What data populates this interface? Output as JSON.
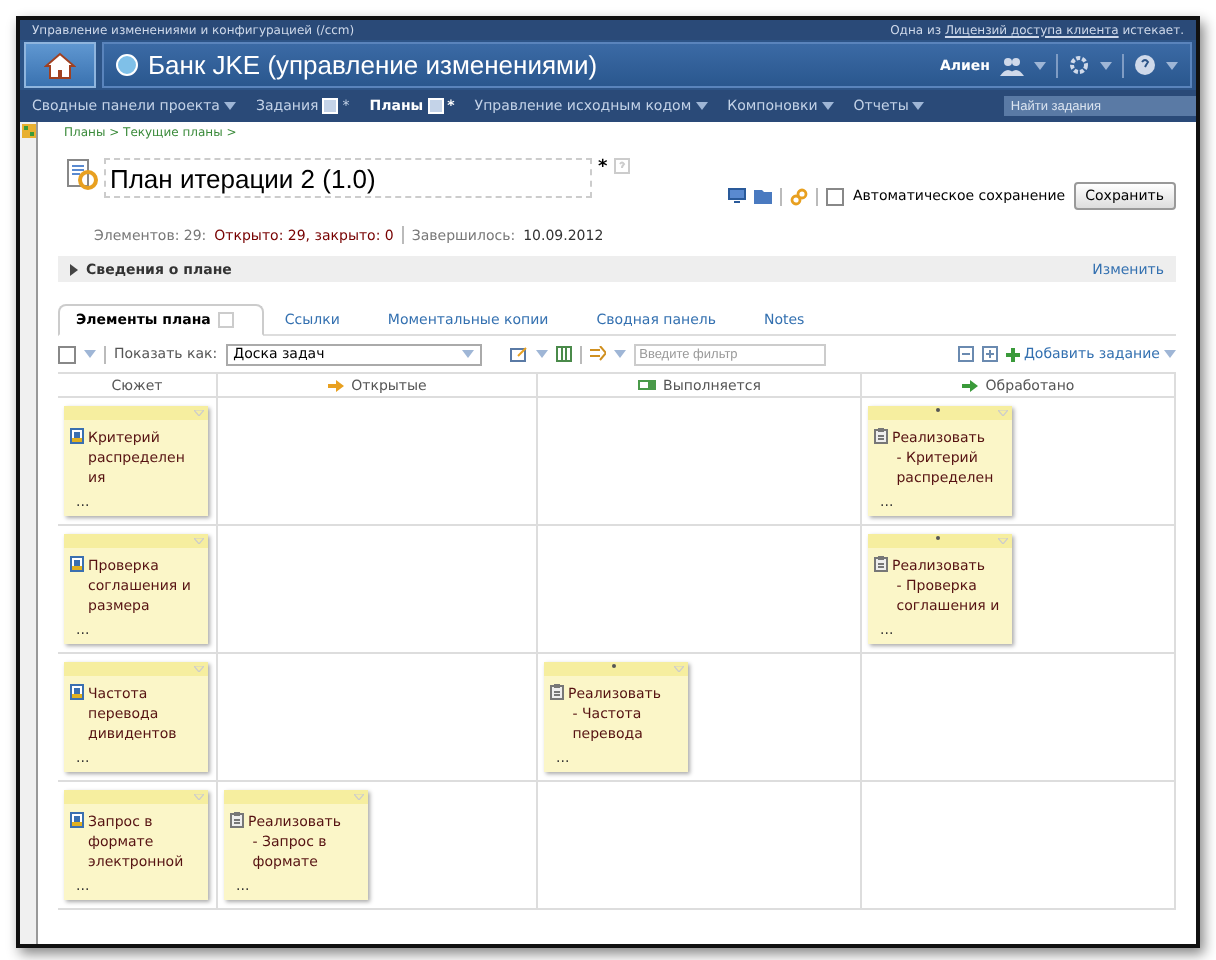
{
  "top_strip": {
    "app": "Управление изменениями и конфигурацией (/ccm)",
    "notice_before": "Одна из",
    "notice_link": "Лицензий доступа клиента",
    "notice_after": "истекает."
  },
  "header": {
    "title": "Банк JKE (управление изменениями)",
    "user": "Алиен"
  },
  "nav": [
    {
      "label": "Сводные панели проекта",
      "kind": "menu",
      "selected": false
    },
    {
      "label": "Задания",
      "kind": "new",
      "selected": false
    },
    {
      "label": "Планы",
      "kind": "new",
      "selected": true
    },
    {
      "label": "Управление исходным кодом",
      "kind": "menu",
      "selected": false
    },
    {
      "label": "Компоновки",
      "kind": "menu",
      "selected": false
    },
    {
      "label": "Отчеты",
      "kind": "menu",
      "selected": false
    }
  ],
  "search": {
    "placeholder": "Найти задания"
  },
  "breadcrumb": "Планы > Текущие планы >",
  "plan": {
    "title": "План итерации 2 (1.0)",
    "modified_mark": "*",
    "autosave_label": "Автоматическое сохранение",
    "autosave": false,
    "save": "Сохранить"
  },
  "stats": {
    "items": "Элементов: 29:",
    "open_closed": "Открыто: 29, закрыто: 0",
    "ended_label": "Завершилось:",
    "ended_date": "10.09.2012"
  },
  "details": {
    "label": "Сведения о плане",
    "expanded": false,
    "edit": "Изменить"
  },
  "tabs": [
    {
      "label": "Элементы плана",
      "selected": true
    },
    {
      "label": "Ссылки",
      "selected": false
    },
    {
      "label": "Моментальные копии",
      "selected": false
    },
    {
      "label": "Сводная панель",
      "selected": false
    },
    {
      "label": "Notes",
      "selected": false
    }
  ],
  "toolbar": {
    "select_all": false,
    "show_as_label": "Показать как:",
    "view": "Доска задач",
    "filter_placeholder": "Введите фильтр",
    "add": "Добавить задание"
  },
  "columns": [
    {
      "label": "Сюжет",
      "kind": "story"
    },
    {
      "label": "Открытые",
      "kind": "open"
    },
    {
      "label": "Выполняется",
      "kind": "progress"
    },
    {
      "label": "Обработано",
      "kind": "done"
    }
  ],
  "rows": [
    {
      "cells": [
        [
          {
            "kind": "story",
            "lines": [
              "Критерий",
              "распределен",
              "ия"
            ],
            "flagged": false,
            "more": "..."
          }
        ],
        [],
        [],
        [
          {
            "kind": "task",
            "lines": [
              "Реализовать",
              "- Критерий",
              "распределен"
            ],
            "flagged": true,
            "more": "..."
          }
        ]
      ]
    },
    {
      "cells": [
        [
          {
            "kind": "story",
            "lines": [
              "Проверка",
              "соглашения и",
              "размера"
            ],
            "flagged": false,
            "more": "..."
          }
        ],
        [],
        [],
        [
          {
            "kind": "task",
            "lines": [
              "Реализовать",
              "- Проверка",
              "соглашения и"
            ],
            "flagged": true,
            "more": "..."
          }
        ]
      ]
    },
    {
      "cells": [
        [
          {
            "kind": "story",
            "lines": [
              "Частота",
              "перевода",
              "дивидентов"
            ],
            "flagged": false,
            "more": "..."
          }
        ],
        [],
        [
          {
            "kind": "task",
            "lines": [
              "Реализовать",
              "- Частота",
              "перевода"
            ],
            "flagged": true,
            "more": "..."
          }
        ],
        []
      ]
    },
    {
      "cells": [
        [
          {
            "kind": "story",
            "lines": [
              "Запрос в",
              "формате",
              "электронной"
            ],
            "flagged": false,
            "more": "..."
          }
        ],
        [
          {
            "kind": "task",
            "lines": [
              "Реализовать",
              "- Запрос в",
              "формате"
            ],
            "flagged": false,
            "more": "..."
          }
        ],
        [],
        []
      ]
    }
  ]
}
